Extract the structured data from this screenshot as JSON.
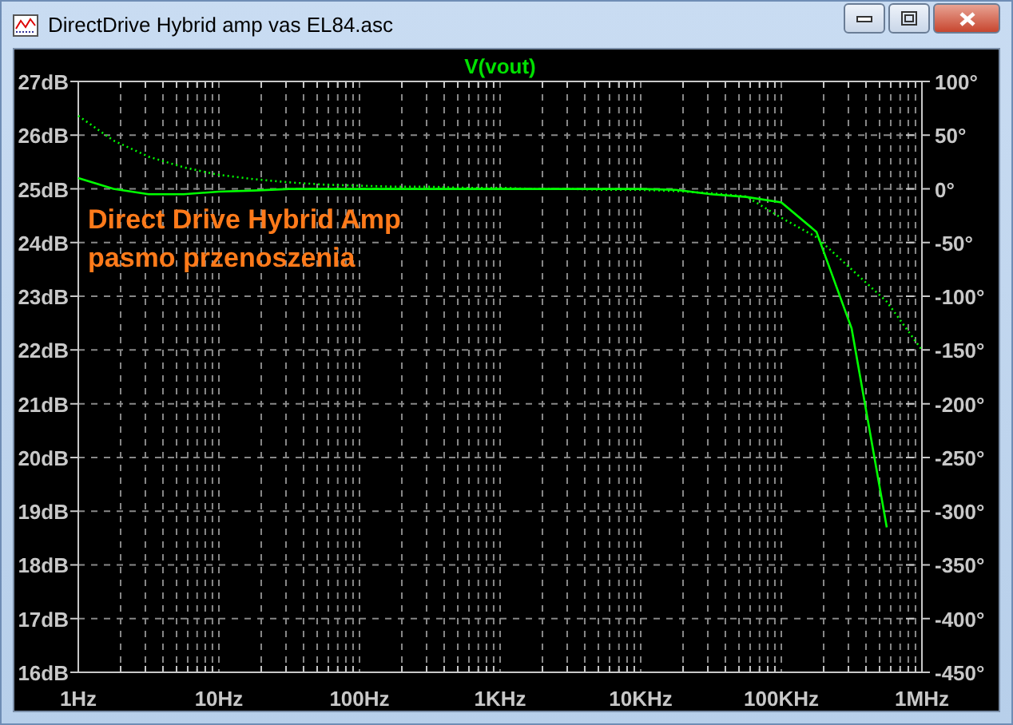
{
  "window": {
    "title": "DirectDrive Hybrid amp vas EL84.asc"
  },
  "plot": {
    "magnitude": {
      "chart_data": {
        "type": "line",
        "title": "V(vout)",
        "grid": true,
        "categories": [
          "1Hz",
          null,
          null,
          null,
          "10Hz",
          null,
          null,
          null,
          "100Hz",
          null,
          null,
          null,
          "1KHz",
          null,
          null,
          null,
          "10KHz",
          null,
          null,
          null,
          "100KHz",
          null,
          null,
          null,
          "1MHz"
        ],
        "series": [
          {
            "color": "#00ff00",
            "values": [
              25.2,
              25.0,
              24.9,
              24.9,
              24.95,
              24.97,
              25.0,
              25.0,
              25.0,
              25.0,
              25.0,
              25.0,
              25.0,
              25.0,
              25.0,
              25.0,
              25.0,
              24.98,
              24.9,
              24.85,
              24.75,
              24.2,
              22.4,
              18.7,
              null
            ]
          }
        ],
        "ylim": [
          16,
          27
        ],
        "yticks": [
          {
            "value": 27,
            "label": "27dB"
          },
          {
            "value": 26,
            "label": "26dB"
          },
          {
            "value": 25,
            "label": "25dB"
          },
          {
            "value": 24,
            "label": "24dB"
          },
          {
            "value": 23,
            "label": "23dB"
          },
          {
            "value": 22,
            "label": "22dB"
          },
          {
            "value": 21,
            "label": "21dB"
          },
          {
            "value": 20,
            "label": "20dB"
          },
          {
            "value": 19,
            "label": "19dB"
          },
          {
            "value": 18,
            "label": "18dB"
          },
          {
            "value": 17,
            "label": "17dB"
          },
          {
            "value": 16,
            "label": "16dB"
          }
        ],
        "annotations": [
          "Direct Drive Hybrid Amp",
          "pasmo przenoszenia"
        ]
      }
    },
    "phase": {
      "chart_data": {
        "type": "line",
        "series": [
          {
            "color": "#00ff00",
            "line_style": "dotted",
            "values": [
              68,
              45,
              30,
              20,
              13,
              9,
              6,
              4,
              3,
              2,
              2,
              1,
              1,
              0,
              0,
              -1,
              -1,
              -2,
              -4,
              -7,
              -27,
              -45,
              -75,
              -105,
              -150
            ]
          }
        ],
        "ylim": [
          -450,
          100
        ],
        "yticks": [
          {
            "value": 100,
            "label": "100°"
          },
          {
            "value": 50,
            "label": "50°"
          },
          {
            "value": 0,
            "label": "0°"
          },
          {
            "value": -50,
            "label": "-50°"
          },
          {
            "value": -100,
            "label": "-100°"
          },
          {
            "value": -150,
            "label": "-150°"
          },
          {
            "value": -200,
            "label": "-200°"
          },
          {
            "value": -250,
            "label": "-250°"
          },
          {
            "value": -300,
            "label": "-300°"
          },
          {
            "value": -350,
            "label": "-350°"
          },
          {
            "value": -400,
            "label": "-400°"
          },
          {
            "value": -450,
            "label": "-450°"
          }
        ]
      }
    }
  }
}
